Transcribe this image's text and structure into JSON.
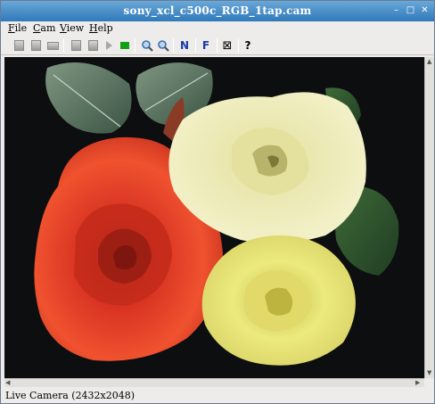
{
  "window": {
    "title": "sony_xcl_c500c_RGB_1tap.cam",
    "controls": {
      "minimize": "–",
      "maximize": "□",
      "close": "✕"
    }
  },
  "menu": [
    {
      "label": "File",
      "mnemonic": "F",
      "rest": "ile"
    },
    {
      "label": "Cam",
      "mnemonic": "C",
      "rest": "am"
    },
    {
      "label": "View",
      "mnemonic": "V",
      "rest": "iew"
    },
    {
      "label": "Help",
      "mnemonic": "H",
      "rest": "elp"
    }
  ],
  "toolbar": {
    "normal_label": "N",
    "fit_label": "F",
    "close_glyph": "⊠",
    "help_label": "?",
    "colors": {
      "normal": "#1a3aa8",
      "fit": "#1a3aa8",
      "green": "#14a014",
      "zoom": "#3a6fb0"
    }
  },
  "status": {
    "text": "Live Camera (2432x2048)"
  }
}
